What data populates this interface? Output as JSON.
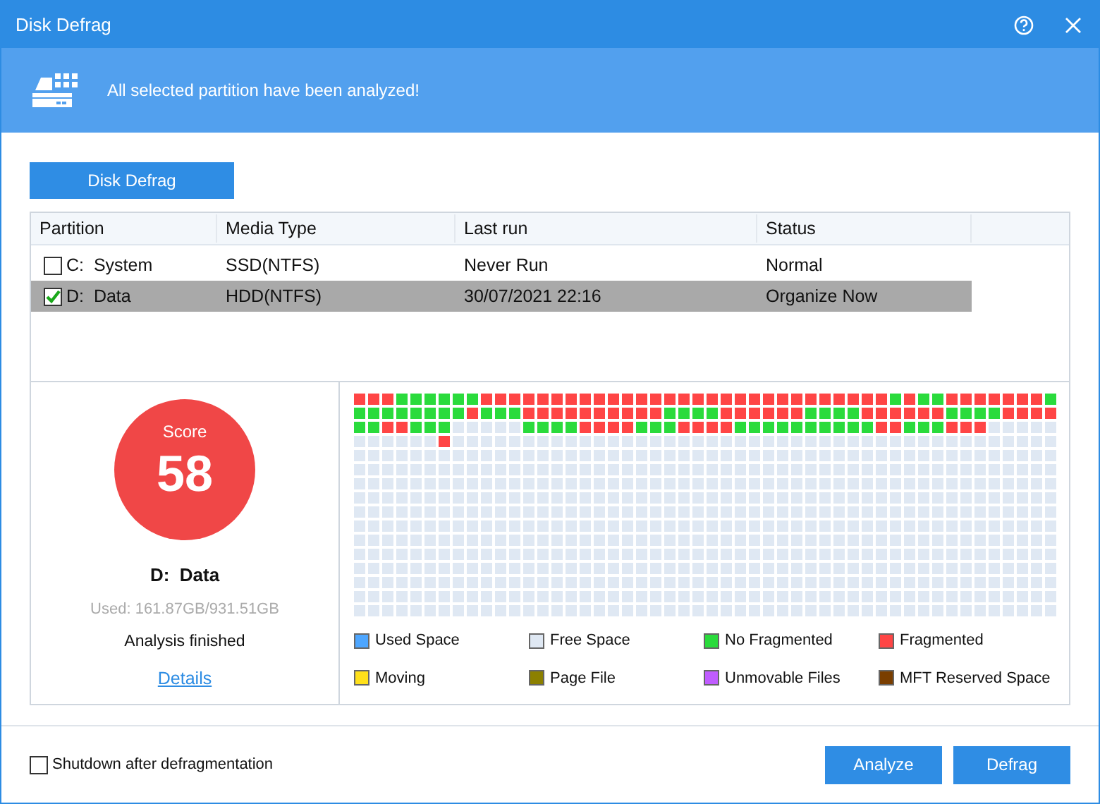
{
  "window": {
    "title": "Disk Defrag"
  },
  "banner": {
    "message": "All selected partition have been analyzed!"
  },
  "top_button": "Disk Defrag",
  "table": {
    "columns": [
      "Partition",
      "Media Type",
      "Last run",
      "Status"
    ],
    "rows": [
      {
        "partition": "C:  System",
        "media_type": "SSD(NTFS)",
        "last_run": "Never Run",
        "status": "Normal",
        "checked": false,
        "selected": false
      },
      {
        "partition": "D:  Data",
        "media_type": "HDD(NTFS)",
        "last_run": "30/07/2021 22:16",
        "status": "Organize Now",
        "checked": true,
        "selected": true
      }
    ]
  },
  "summary": {
    "score_label": "Score",
    "score": "58",
    "partition": "D:  Data",
    "used": "Used: 161.87GB/931.51GB",
    "status": "Analysis finished",
    "link": "Details"
  },
  "block_map": {
    "legend": [
      {
        "label": "Used Space",
        "color": "#4da6ff"
      },
      {
        "label": "Free Space",
        "color": "#dfe8f3"
      },
      {
        "label": "No Fragmented",
        "color": "#2adb3c"
      },
      {
        "label": "Fragmented",
        "color": "#ff4545"
      },
      {
        "label": "Moving",
        "color": "#ffe01a"
      },
      {
        "label": "Page File",
        "color": "#8c8000"
      },
      {
        "label": "Unmovable Files",
        "color": "#c05cff"
      },
      {
        "label": "MFT Reserved Space",
        "color": "#7a3e00"
      }
    ]
  },
  "footer": {
    "shutdown_label": "Shutdown after defragmentation",
    "shutdown_checked": false,
    "buttons": [
      "Analyze",
      "Defrag"
    ]
  }
}
